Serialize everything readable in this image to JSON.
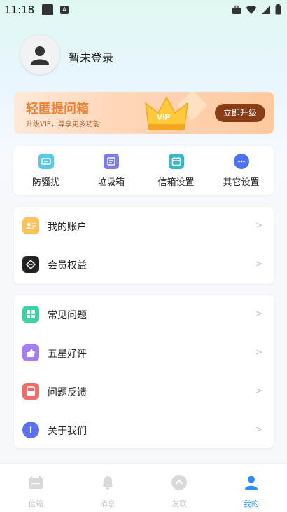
{
  "status_bar": {
    "time": "11:18",
    "a_glyph": "A"
  },
  "profile": {
    "username": "暂未登录"
  },
  "banner": {
    "title": "轻匿提问箱",
    "subtitle": "升级VIP，尊享更多功能",
    "button": "立即升级",
    "crown_text": "VIP"
  },
  "quick_actions": [
    {
      "label": "防骚扰",
      "icon": "shield-mail-icon",
      "color": "#5ac8e8"
    },
    {
      "label": "垃圾箱",
      "icon": "trash-box-icon",
      "color": "#7b7cf0"
    },
    {
      "label": "信箱设置",
      "icon": "mailbox-settings-icon",
      "color": "#3fb6c8"
    },
    {
      "label": "其它设置",
      "icon": "more-settings-icon",
      "color": "#4d72f5"
    }
  ],
  "list_group_1": [
    {
      "label": "我的账户",
      "icon": "account-icon",
      "color": "#ffc15a"
    },
    {
      "label": "会员权益",
      "icon": "diamond-icon",
      "color": "#222222"
    }
  ],
  "list_group_2": [
    {
      "label": "常见问题",
      "icon": "faq-grid-icon",
      "color": "#39d3a6"
    },
    {
      "label": "五星好评",
      "icon": "thumbs-up-icon",
      "color": "#a57cf2"
    },
    {
      "label": "问题反馈",
      "icon": "feedback-icon",
      "color": "#f36c6c"
    },
    {
      "label": "关于我们",
      "icon": "info-icon",
      "color": "#5b6ff0"
    }
  ],
  "chevron": ">",
  "nav": [
    {
      "label": "信箱",
      "icon": "mailbox-tab-icon",
      "active": false
    },
    {
      "label": "消息",
      "icon": "bell-tab-icon",
      "active": false
    },
    {
      "label": "友联",
      "icon": "link-tab-icon",
      "active": false
    },
    {
      "label": "我的",
      "icon": "profile-tab-icon",
      "active": true
    }
  ],
  "colors": {
    "accent": "#2a8cff",
    "banner_btn": "#8a3d15",
    "banner_title": "#e8823a"
  }
}
